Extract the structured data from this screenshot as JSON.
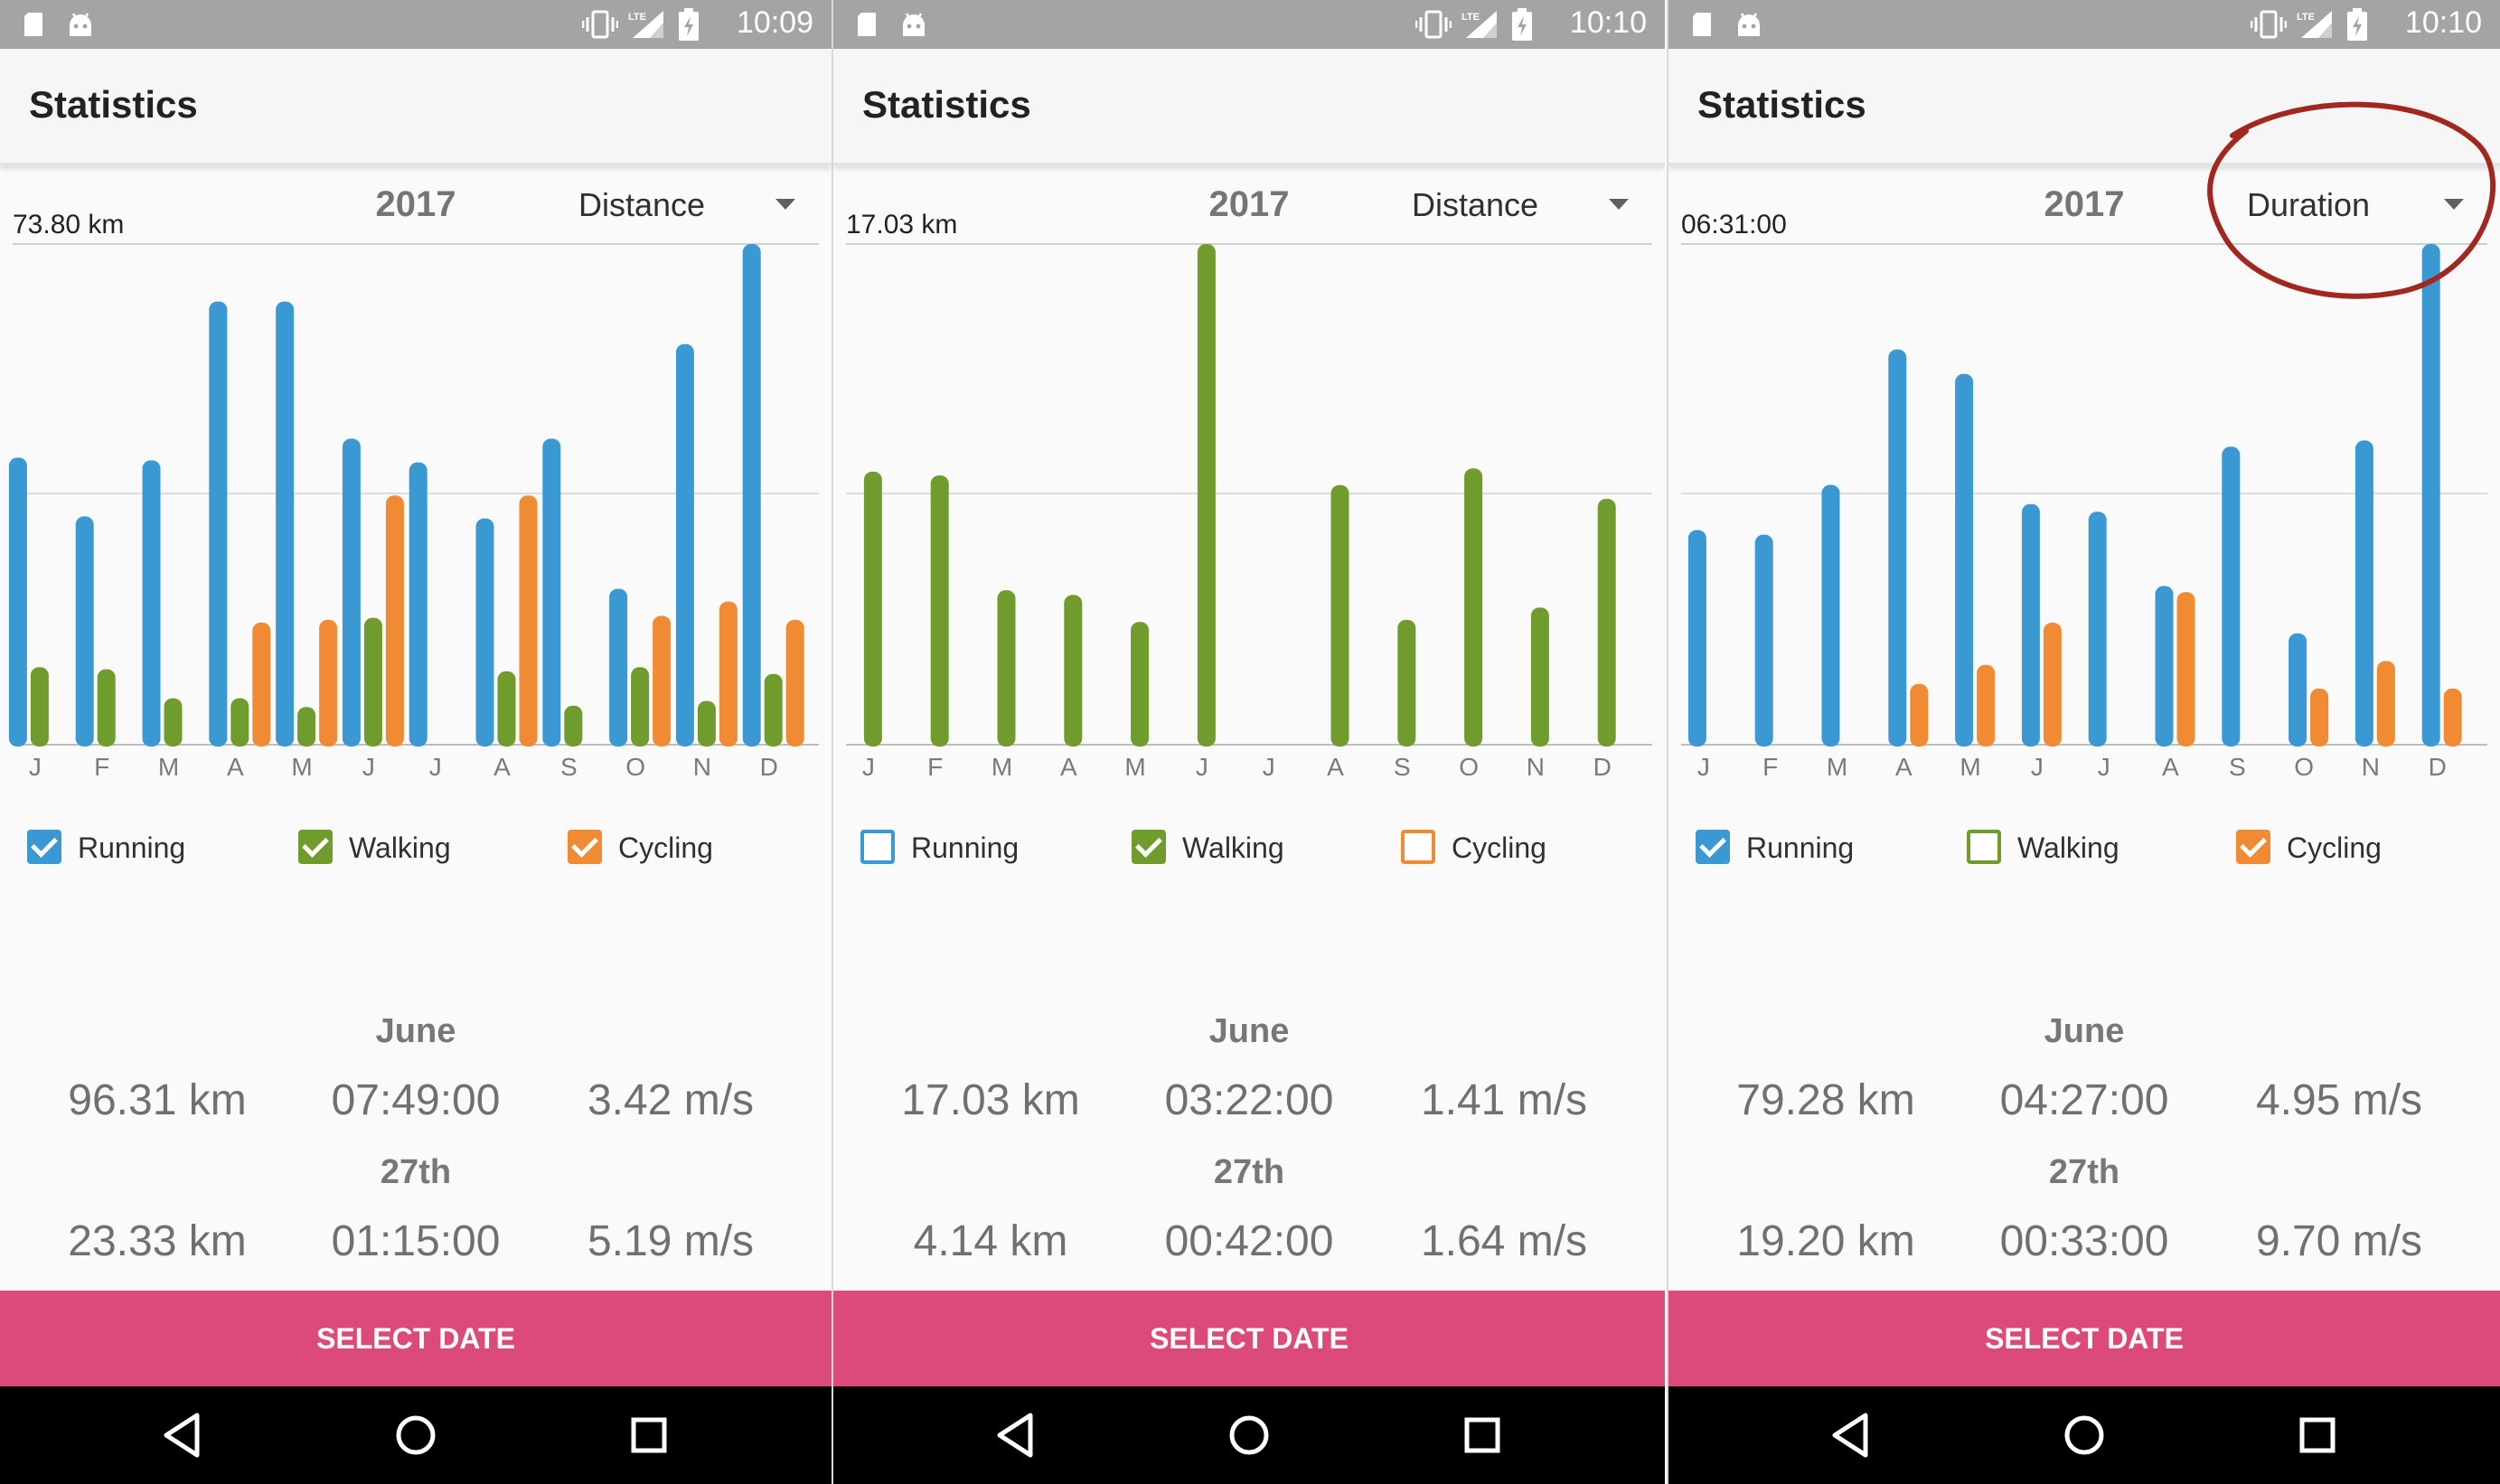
{
  "colors": {
    "running": "#3a99d2",
    "walking": "#6f9c2c",
    "cycling": "#f08a33",
    "accent": "#dc4a7a",
    "annotation": "#a0281f"
  },
  "month_labels": [
    "J",
    "F",
    "M",
    "A",
    "M",
    "J",
    "J",
    "A",
    "S",
    "O",
    "N",
    "D"
  ],
  "panels": [
    {
      "status_time": "10:09",
      "title": "Statistics",
      "year": "2017",
      "metric": "Distance",
      "max_label": "73.80 km",
      "legend": [
        {
          "label": "Running",
          "checked": true
        },
        {
          "label": "Walking",
          "checked": true
        },
        {
          "label": "Cycling",
          "checked": true
        }
      ],
      "month": "June",
      "month_stats": [
        "96.31 km",
        "07:49:00",
        "3.42 m/s"
      ],
      "day": "27th",
      "day_stats": [
        "23.33 km",
        "01:15:00",
        "5.19 m/s"
      ],
      "button": "SELECT DATE",
      "chart_data": {
        "type": "bar",
        "categories": [
          "J",
          "F",
          "M",
          "A",
          "M",
          "J",
          "J",
          "A",
          "S",
          "O",
          "N",
          "D"
        ],
        "ylim": [
          0,
          73.8
        ],
        "grid": true,
        "series": [
          {
            "name": "Running",
            "values": [
              42.2,
              33.5,
              41.8,
              65.3,
              65.3,
              45.0,
              41.5,
              33.2,
              45.0,
              22.8,
              59.0,
              73.8
            ]
          },
          {
            "name": "Walking",
            "values": [
              11.2,
              10.9,
              6.6,
              6.6,
              5.3,
              18.5,
              0,
              10.6,
              5.5,
              11.2,
              6.2,
              10.2
            ]
          },
          {
            "name": "Cycling",
            "values": [
              0,
              0,
              0,
              17.8,
              18.2,
              36.6,
              0,
              36.6,
              0,
              18.8,
              20.9,
              18.2
            ]
          }
        ]
      }
    },
    {
      "status_time": "10:10",
      "title": "Statistics",
      "year": "2017",
      "metric": "Distance",
      "max_label": "17.03 km",
      "legend": [
        {
          "label": "Running",
          "checked": false
        },
        {
          "label": "Walking",
          "checked": true
        },
        {
          "label": "Cycling",
          "checked": false
        }
      ],
      "month": "June",
      "month_stats": [
        "17.03 km",
        "03:22:00",
        "1.41 m/s"
      ],
      "day": "27th",
      "day_stats": [
        "4.14 km",
        "00:42:00",
        "1.64 m/s"
      ],
      "button": "SELECT DATE",
      "chart_data": {
        "type": "bar",
        "categories": [
          "J",
          "F",
          "M",
          "A",
          "M",
          "J",
          "J",
          "A",
          "S",
          "O",
          "N",
          "D"
        ],
        "ylim": [
          0,
          17.03
        ],
        "grid": true,
        "series": [
          {
            "name": "Walking",
            "values": [
              9.26,
              9.13,
              5.21,
              5.05,
              4.13,
              17.03,
              0,
              8.8,
              4.2,
              9.37,
              4.62,
              8.33
            ]
          }
        ]
      }
    },
    {
      "status_time": "10:10",
      "title": "Statistics",
      "year": "2017",
      "metric": "Duration",
      "max_label": "06:31:00",
      "legend": [
        {
          "label": "Running",
          "checked": true
        },
        {
          "label": "Walking",
          "checked": false
        },
        {
          "label": "Cycling",
          "checked": true
        }
      ],
      "month": "June",
      "month_stats": [
        "79.28 km",
        "04:27:00",
        "4.95 m/s"
      ],
      "day": "27th",
      "day_stats": [
        "19.20 km",
        "00:33:00",
        "9.70 m/s"
      ],
      "button": "SELECT DATE",
      "chart_data": {
        "type": "bar",
        "categories": [
          "J",
          "F",
          "M",
          "A",
          "M",
          "J",
          "J",
          "A",
          "S",
          "O",
          "N",
          "D"
        ],
        "ylim": [
          0,
          6.517
        ],
        "grid": true,
        "series": [
          {
            "name": "Running",
            "values": [
              2.78,
              2.72,
              3.37,
              5.14,
              4.82,
              3.12,
              3.02,
              2.05,
              3.87,
              1.43,
              3.95,
              6.517
            ]
          },
          {
            "name": "Cycling",
            "values": [
              0,
              0,
              0,
              0.77,
              1.02,
              1.57,
              0,
              1.97,
              0,
              0.71,
              1.07,
              0.71
            ]
          }
        ]
      }
    }
  ]
}
